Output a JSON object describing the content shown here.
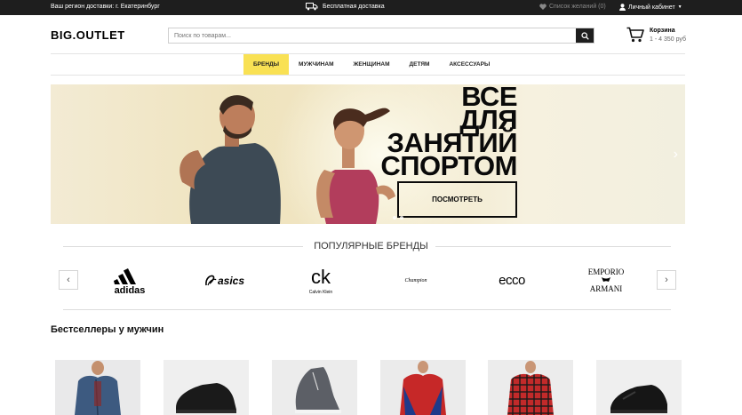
{
  "topbar": {
    "region_label": "Ваш регион доставки:",
    "region_city": "г. Екатеринбург",
    "delivery": "Бесплатная доставка",
    "wishlist": "Список желаний (0)",
    "account": "Личный кабинет"
  },
  "header": {
    "logo": "BIG.OUTLET",
    "search_placeholder": "Поиск по товарам...",
    "cart_title": "Корзина",
    "cart_price": "1 - 4 350 руб"
  },
  "nav": {
    "items": [
      "БРЕНДЫ",
      "МУЖЧИНАМ",
      "ЖЕНЩИНАМ",
      "ДЕТЯМ",
      "АКСЕССУАРЫ"
    ],
    "active_index": 0
  },
  "banner": {
    "line1": "ВСЕ",
    "line2": "ДЛЯ",
    "line3": "ЗАНЯТИЙ",
    "line4": "СПОРТОМ",
    "button": "ПОСМОТРЕТЬ"
  },
  "brands": {
    "title": "ПОПУЛЯРНЫЕ БРЕНДЫ",
    "logos": [
      "adidas",
      "asics",
      "ck",
      "Calvin Klein",
      "Champion",
      "ecco",
      "EMPORIO",
      "ARMANI"
    ]
  },
  "bestsellers": {
    "title": "Бестселлеры у мужчин",
    "products": [
      "denim-jacket",
      "black-sneakers",
      "grey-sneakers",
      "red-jacket",
      "plaid-shirt",
      "black-runner-sneakers"
    ]
  },
  "colors": {
    "accent": "#f9e154",
    "dark": "#1e1e1e"
  }
}
